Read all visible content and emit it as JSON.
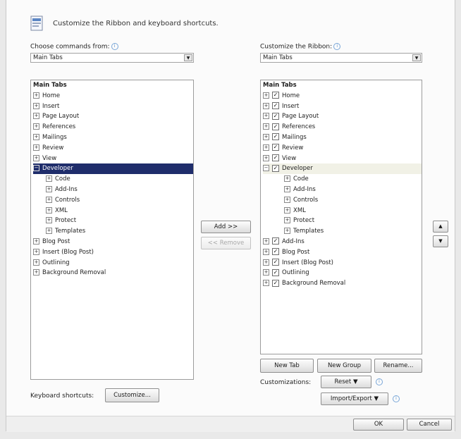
{
  "header": {
    "title": "Customize the Ribbon and keyboard shortcuts.",
    "icon": "ribbon-options-icon"
  },
  "left": {
    "label": "Choose commands from:",
    "combo_value": "Main Tabs",
    "list_header": "Main Tabs",
    "items": [
      "Home",
      "Insert",
      "Page Layout",
      "References",
      "Mailings",
      "Review",
      "View",
      "Developer",
      "Code",
      "Add-Ins",
      "Controls",
      "XML",
      "Protect",
      "Templates",
      "Blog Post",
      "Insert (Blog Post)",
      "Outlining",
      "Background Removal"
    ]
  },
  "right": {
    "label": "Customize the Ribbon:",
    "combo_value": "Main Tabs",
    "list_header": "Main Tabs",
    "items": [
      "Home",
      "Insert",
      "Page Layout",
      "References",
      "Mailings",
      "Review",
      "View",
      "Developer",
      "Code",
      "Add-Ins",
      "Controls",
      "XML",
      "Protect",
      "Templates",
      "Add-Ins",
      "Blog Post",
      "Insert (Blog Post)",
      "Outlining",
      "Background Removal"
    ]
  },
  "middle": {
    "add": "Add >>",
    "remove": "<< Remove"
  },
  "order": {
    "up": "▲",
    "down": "▼"
  },
  "buttons": {
    "new_tab": "New Tab",
    "new_group": "New Group",
    "rename": "Rename..."
  },
  "customizations": {
    "label": "Customizations:",
    "reset": "Reset ▼",
    "import_export": "Import/Export ▼"
  },
  "keyboard": {
    "label": "Keyboard shortcuts:",
    "customize": "Customize..."
  },
  "footer": {
    "ok": "OK",
    "cancel": "Cancel"
  },
  "colors": {
    "selection": "#1f2d6b",
    "accent_info": "#4a86c8"
  }
}
